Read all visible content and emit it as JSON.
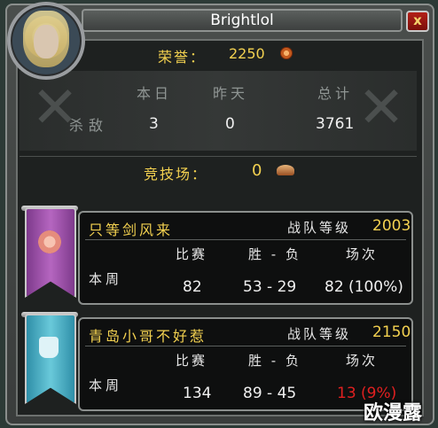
{
  "window": {
    "title": "Brightlol",
    "close_label": "x"
  },
  "honor": {
    "label": "荣誉：",
    "value": "2250"
  },
  "kills": {
    "headers": [
      "本日",
      "昨天",
      "总计"
    ],
    "row_label": "杀敌",
    "values": [
      "3",
      "0",
      "3761"
    ]
  },
  "arena": {
    "label": "竞技场：",
    "value": "0"
  },
  "teams": [
    {
      "name": "只等剑风来",
      "rating_label": "战队等级",
      "rating": "2003",
      "banner_color": "#a155b2",
      "headers": [
        "比赛",
        "胜 - 负",
        "场次"
      ],
      "week_label": "本周",
      "games": "82",
      "win_loss": "53 - 29",
      "played": "82 (100%)",
      "played_color": "#f0f0f0"
    },
    {
      "name": "青岛小哥不好惹",
      "rating_label": "战队等级",
      "rating": "2150",
      "banner_color": "#56b8cc",
      "headers": [
        "比赛",
        "胜 - 负",
        "场次"
      ],
      "week_label": "本周",
      "games": "134",
      "win_loss": "89 - 45",
      "played": "13 (9%)",
      "played_color": "#e02020"
    }
  ],
  "watermark": "欧漫露"
}
